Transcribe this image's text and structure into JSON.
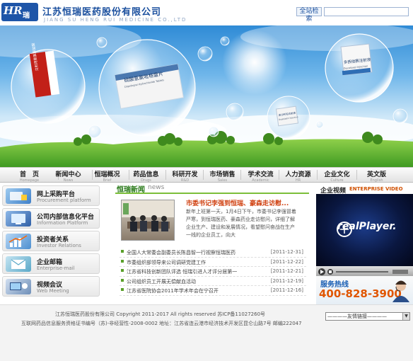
{
  "header": {
    "logo_text": "瑞",
    "company_cn": "江苏恒瑞医药股份有限公司",
    "company_en": "JIANG SU HENG RUI MEDICINE CO.,LTD",
    "search_label": "全站检索",
    "search_value": ""
  },
  "banner": {
    "products": [
      {
        "name": "注射用氨氯胺盐酸",
        "en": ""
      },
      {
        "name": "硫酸氢氯吡格雷片",
        "en": "Clopidogrel Hydrochloride Tablets"
      },
      {
        "name": "多西他赛注射液",
        "en": "Docetaxel Injection"
      },
      {
        "name": "奥沙利铂注射液",
        "en": "Oxaliplatin Injection"
      }
    ]
  },
  "nav": {
    "items": [
      {
        "cn": "首　页",
        "en": "Homepage"
      },
      {
        "cn": "新闻中心",
        "en": "News"
      },
      {
        "cn": "恒瑞概况",
        "en": "Brief"
      },
      {
        "cn": "药品信息",
        "en": "Drugs"
      },
      {
        "cn": "科研开发",
        "en": "R&D"
      },
      {
        "cn": "市场销售",
        "en": "Sales"
      },
      {
        "cn": "学术交流",
        "en": "Academic"
      },
      {
        "cn": "人力资源",
        "en": "HR"
      },
      {
        "cn": "企业文化",
        "en": "Culture"
      },
      {
        "cn": "英文版",
        "en": "English"
      }
    ]
  },
  "sidebar": {
    "items": [
      {
        "title": "网上采购平台",
        "sub": "Procurement platform",
        "icon": "procurement-icon",
        "color": "#5a9bd6"
      },
      {
        "title": "公司内部信息化平台",
        "sub": "Information Platform",
        "icon": "information-icon",
        "color": "#3b6fb6"
      },
      {
        "title": "投资者关系",
        "sub": "Investor Relations",
        "icon": "investor-icon",
        "color": "#4d8fd0"
      },
      {
        "title": "企业邮箱",
        "sub": "Enterprise-mail",
        "icon": "mail-icon",
        "color": "#5aa8c8"
      },
      {
        "title": "视频会议",
        "sub": "Web Meeting",
        "icon": "meeting-icon",
        "color": "#6f8fb8"
      }
    ]
  },
  "news": {
    "title": "恒瑞新闻",
    "title_en": "news",
    "headline": "市委书记李强到恒瑞、豪森走访慰...",
    "summary": "新年上班第一天，1月4日下午，市委书记李强冒着严寒，到恒瑞医药、豪森药业走访慰问，详细了解企业生产、建设和发展情况，看望慰问奋战在生产一线的企业员工，向大",
    "items": [
      {
        "title": "全国人大常委会副委员长陈昌智一行视察恒瑞医药",
        "date": "[2011-12-31]"
      },
      {
        "title": "市委组织部领导来公司调研党建工作",
        "date": "[2011-12-22]"
      },
      {
        "title": "江苏省科技创新团队评选 恒瑞引进人才评分居第一",
        "date": "[2011-12-21]"
      },
      {
        "title": "公司组织员工开展无偿献血活动",
        "date": "[2011-12-19]"
      },
      {
        "title": "江苏省医院协会2011年学术年会在宁召开",
        "date": "[2011-12-16]"
      }
    ]
  },
  "video": {
    "title": "企业视频",
    "title_en": "ENTERPRISE VIDEO",
    "player_logo": "realPlayer.",
    "hotline_label": "服务热线",
    "hotline_number": "400-828-3900"
  },
  "footer": {
    "copyright": "江苏恒瑞医药股份有限公司 Copyright 2011-2017 All rights reserved 苏ICP备11027260号",
    "address": "互联网药品信息服务资格证书编号（苏)-非经营性-2008-0002 地址：江苏省连云港市经济技术开发区昆仑山路7号 邮编222047",
    "links_select": "————友情链接————"
  },
  "colors": {
    "brand_blue": "#1a4f9e",
    "news_green": "#2a7a1a",
    "hotline_orange": "#e05500"
  }
}
